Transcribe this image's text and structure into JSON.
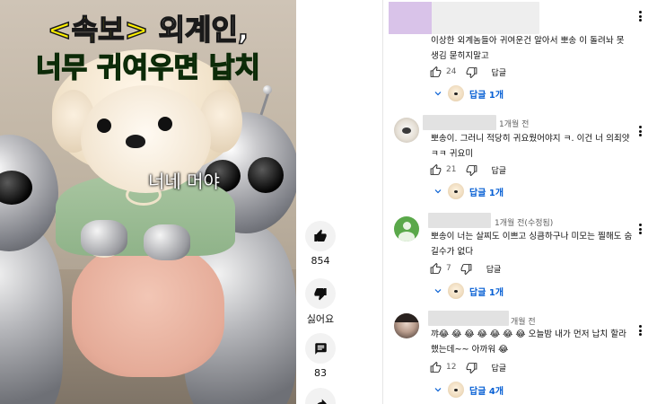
{
  "video": {
    "headline_line1_bracket": "<속보>",
    "headline_line1_rest": " 외계인,",
    "headline_line2": "너무 귀여우면 납치",
    "subtitle": "너네 머야"
  },
  "actions": {
    "like_count": "854",
    "dislike_label": "싫어요",
    "comment_count": "83"
  },
  "comments": [
    {
      "time": "",
      "text": "이상한 외계놈들아 귀여운건 알아서 뽀송 이 돌려놔 못 생김 묻히지말고",
      "likes": "24",
      "reply_label": "답글",
      "replies": "답글 1개"
    },
    {
      "time": "1개월 전",
      "text": "뽀송이. 그러니 적당히 귀요웠어야지 ㅋ. 이건 너 의죄얏 ㅋㅋ 귀요미",
      "likes": "21",
      "reply_label": "답글",
      "replies": "답글 1개"
    },
    {
      "time": "1개월 전(수정됨)",
      "text": "뽀송이 너는 살찌도 이쁘고 싱큼하구나 미모는 찔해도 숨길수가 없다",
      "likes": "7",
      "reply_label": "답글",
      "replies": "답글 1개"
    },
    {
      "time": "개월 전",
      "text": "꺄😂 😂 😂 😂 😂 😂 😂 오늘밤 내가 먼저 납치 할라했는데~~ 아까워 😂",
      "likes": "12",
      "reply_label": "답글",
      "replies": "답글 4개"
    }
  ],
  "colors": {
    "link_blue": "#065fd4",
    "headline_yellow": "#fff200",
    "headline_green": "#55e34a",
    "avatar_lavender": "#d9c3e9",
    "avatar_green": "#5aa84a"
  }
}
